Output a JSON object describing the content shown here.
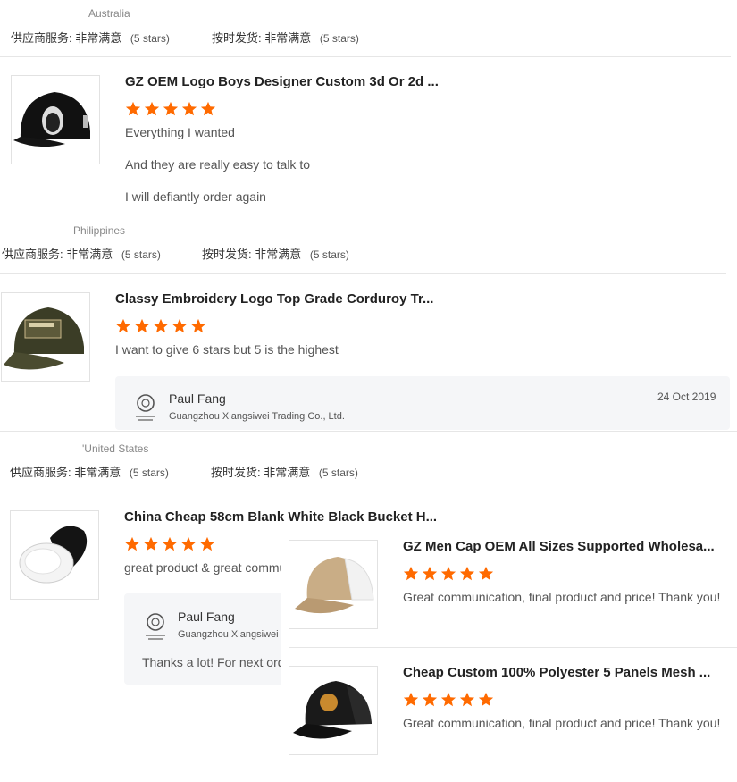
{
  "reviews": [
    {
      "country": "Australia",
      "supplier_service_label": "供应商服务:",
      "supplier_service_value": "非常满意",
      "supplier_service_stars": "(5 stars)",
      "delivery_label": "按时发货:",
      "delivery_value": "非常满意",
      "delivery_stars": "(5 stars)"
    },
    {
      "product_title": "GZ OEM Logo Boys Designer Custom 3d Or 2d ...",
      "rating": 5,
      "lines": [
        "Everything I wanted",
        "And they are really easy to talk to",
        "I will defiantly order again"
      ],
      "country": "Philippines",
      "supplier_service_label": "供应商服务:",
      "supplier_service_value": "非常满意",
      "supplier_service_stars": "(5 stars)",
      "delivery_label": "按时发货:",
      "delivery_value": "非常满意",
      "delivery_stars": "(5 stars)"
    },
    {
      "product_title": "Classy Embroidery Logo Top Grade Corduroy Tr...",
      "rating": 5,
      "lines": [
        "I want to give 6 stars but 5 is the highest"
      ],
      "reply": {
        "name": "Paul Fang",
        "company": "Guangzhou Xiangsiwei Trading Co., Ltd.",
        "date": "24 Oct 2019"
      }
    },
    {
      "country": "'United States",
      "supplier_service_label": "供应商服务:",
      "supplier_service_value": "非常满意",
      "supplier_service_stars": "(5 stars)",
      "delivery_label": "按时发货:",
      "delivery_value": "非常满意",
      "delivery_stars": "(5 stars)"
    },
    {
      "product_title": "China Cheap 58cm Blank White Black Bucket H...",
      "rating": 5,
      "lines": [
        "great product & great commu"
      ],
      "reply": {
        "name": "Paul Fang",
        "company": "Guangzhou Xiangsiwei",
        "message": "Thanks a lot! For next ord"
      }
    }
  ],
  "overlay_reviews": [
    {
      "product_title": "GZ Men Cap OEM All Sizes Supported Wholesa...",
      "rating": 5,
      "text": "Great communication, final product and price! Thank you!"
    },
    {
      "product_title": "Cheap Custom 100% Polyester 5 Panels Mesh ...",
      "rating": 5,
      "text": "Great communication, final product and price! Thank you!"
    }
  ],
  "icons": {
    "star": "star-icon",
    "logo": "supplier-logo-icon"
  },
  "colors": {
    "star": "#ff6a00",
    "reply_bg": "#f5f6f8",
    "divider": "#e6e6e6"
  }
}
